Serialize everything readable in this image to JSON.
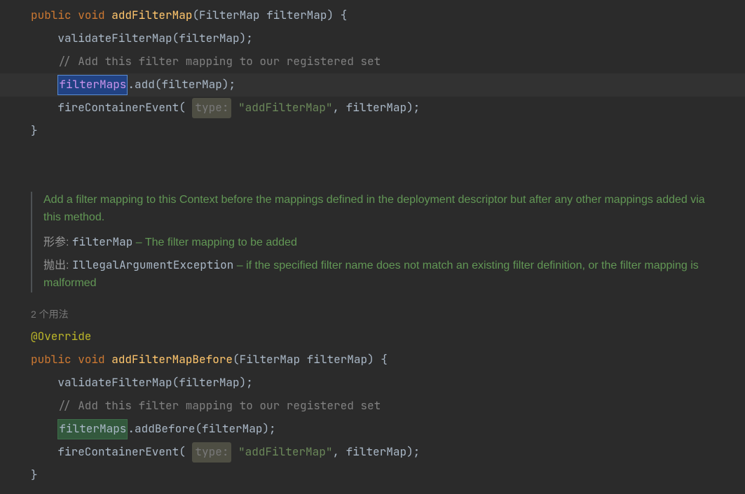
{
  "method1": {
    "sig": {
      "public": "public",
      "void": "void",
      "name": "addFilterMap",
      "paramType": "FilterMap",
      "paramName": "filterMap"
    },
    "line1": {
      "call": "validateFilterMap",
      "arg": "filterMap"
    },
    "comment": "// Add this filter mapping to our registered set",
    "line3": {
      "target": "filterMaps",
      "method": "add",
      "arg": "filterMap"
    },
    "line4": {
      "call": "fireContainerEvent",
      "hintLabel": "type:",
      "str": "\"addFilterMap\"",
      "arg2": "filterMap"
    },
    "close": "}"
  },
  "javadoc": {
    "desc": "Add a filter mapping to this Context before the mappings defined in the deployment descriptor but after any other mappings added via this method.",
    "paramLabel": "形参:",
    "paramName": "filterMap",
    "paramDesc": " – The filter mapping to be added",
    "throwsLabel": "抛出:",
    "throwsType": "IllegalArgumentException",
    "throwsDesc": " – if the specified filter name does not match an existing filter definition, or the filter mapping is malformed"
  },
  "usages": "2 个用法",
  "annotation": "@Override",
  "method2": {
    "sig": {
      "public": "public",
      "void": "void",
      "name": "addFilterMapBefore",
      "paramType": "FilterMap",
      "paramName": "filterMap"
    },
    "line1": {
      "call": "validateFilterMap",
      "arg": "filterMap"
    },
    "comment": "// Add this filter mapping to our registered set",
    "line3": {
      "target": "filterMaps",
      "method": "addBefore",
      "arg": "filterMap"
    },
    "line4": {
      "call": "fireContainerEvent",
      "hintLabel": "type:",
      "str": "\"addFilterMap\"",
      "arg2": "filterMap"
    },
    "close": "}"
  }
}
